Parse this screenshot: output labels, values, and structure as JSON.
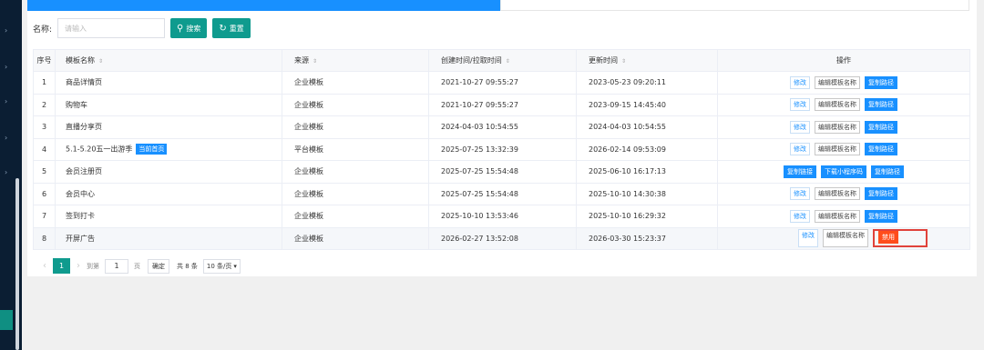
{
  "sidebar": {
    "chevron": "›"
  },
  "search": {
    "label": "名称:",
    "placeholder": "请输入",
    "search_icon": "⚲",
    "search_label": "搜索",
    "reset_icon": "↻",
    "reset_label": "重置"
  },
  "table": {
    "sort_icon": "⇕",
    "headers": [
      "序号",
      "模板名称",
      "来源",
      "创建时间/拉取时间",
      "更新时间",
      "操作"
    ],
    "rows": [
      {
        "no": "1",
        "name": "商品详情页",
        "source": "企业模板",
        "created": "2021-10-27 09:55:27",
        "updated": "2023-05-23 09:20:11",
        "ops": [
          "修改",
          "编辑模板名称",
          "复制路径"
        ]
      },
      {
        "no": "2",
        "name": "购物车",
        "source": "企业模板",
        "created": "2021-10-27 09:55:27",
        "updated": "2023-09-15 14:45:40",
        "ops": [
          "修改",
          "编辑模板名称",
          "复制路径"
        ]
      },
      {
        "no": "3",
        "name": "直播分享页",
        "source": "企业模板",
        "created": "2024-04-03 10:54:55",
        "updated": "2024-04-03 10:54:55",
        "ops": [
          "修改",
          "编辑模板名称",
          "复制路径"
        ]
      },
      {
        "no": "4",
        "name": "5.1-5.20五一出游季",
        "badge": "当前首页",
        "source": "平台模板",
        "created": "2025-07-25 13:32:39",
        "updated": "2026-02-14 09:53:09",
        "ops": [
          "修改",
          "编辑模板名称",
          "复制路径"
        ]
      },
      {
        "no": "5",
        "name": "会员注册页",
        "source": "企业模板",
        "created": "2025-07-25 15:54:48",
        "updated": "2025-06-10 16:17:13",
        "ops": [
          "复制链接",
          "下载小程序码",
          "复制路径"
        ]
      },
      {
        "no": "6",
        "name": "会员中心",
        "source": "企业模板",
        "created": "2025-07-25 15:54:48",
        "updated": "2025-10-10 14:30:38",
        "ops": [
          "修改",
          "编辑模板名称",
          "复制路径"
        ]
      },
      {
        "no": "7",
        "name": "签到打卡",
        "source": "企业模板",
        "created": "2025-10-10 13:53:46",
        "updated": "2025-10-10 16:29:32",
        "ops": [
          "修改",
          "编辑模板名称",
          "复制路径"
        ]
      },
      {
        "no": "8",
        "name": "开屏广告",
        "source": "企业模板",
        "created": "2026-02-27 13:52:08",
        "updated": "2026-03-30 15:23:37",
        "ops": [
          "修改",
          "编辑模板名称",
          "禁用"
        ]
      }
    ]
  },
  "pager": {
    "prev": "‹",
    "current": "1",
    "next": "›",
    "goto_prefix": "到第",
    "goto_value": "1",
    "goto_suffix": "页",
    "confirm": "确定",
    "total": "共 8 条",
    "page_size": "10 条/页",
    "page_size_caret": "▾"
  },
  "colors": {
    "accent": "#0f9b8e",
    "primary": "#1890ff",
    "danger": "#ff4d1c",
    "highlight_box": "#e0423b"
  }
}
